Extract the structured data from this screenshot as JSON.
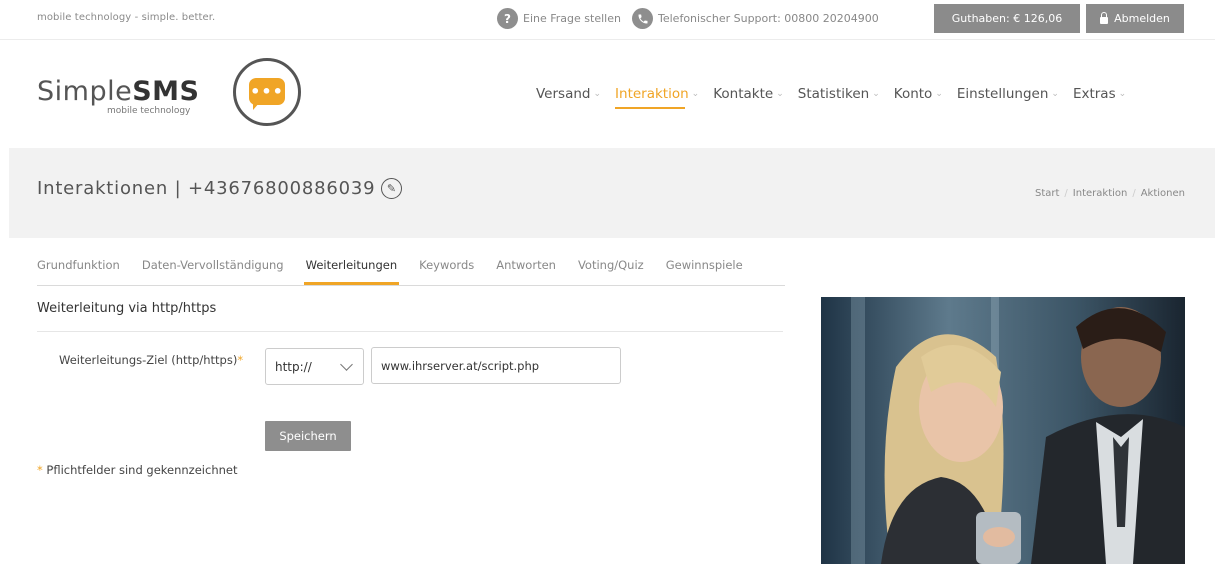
{
  "topbar": {
    "tagline": "mobile technology - simple. better.",
    "help_label": "Eine Frage stellen",
    "help_icon": "question-icon",
    "support_label": "Telefonischer Support: 00800 20204900",
    "support_icon": "phone-icon",
    "balance_label": "Guthaben: € 126,06",
    "logout_label": "Abmelden",
    "logout_icon": "lock-icon"
  },
  "logo": {
    "word_light": "Simple",
    "word_bold": "SMS",
    "subtitle": "mobile technology",
    "bubble_text": "•••"
  },
  "nav": {
    "items": [
      {
        "label": "Versand"
      },
      {
        "label": "Interaktion"
      },
      {
        "label": "Kontakte"
      },
      {
        "label": "Statistiken"
      },
      {
        "label": "Konto"
      },
      {
        "label": "Einstellungen"
      },
      {
        "label": "Extras"
      }
    ],
    "chevron": "⌄"
  },
  "page": {
    "title": "Interaktionen | +43676800886039",
    "edit_glyph": "✎",
    "breadcrumb": [
      "Start",
      "Interaktion",
      "Aktionen"
    ],
    "breadcrumb_sep": "/"
  },
  "tabs": [
    {
      "label": "Grundfunktion"
    },
    {
      "label": "Daten-Vervollständigung"
    },
    {
      "label": "Weiterleitungen"
    },
    {
      "label": "Keywords"
    },
    {
      "label": "Antworten"
    },
    {
      "label": "Voting/Quiz"
    },
    {
      "label": "Gewinnspiele"
    }
  ],
  "form": {
    "section_title": "Weiterleitung via http/https",
    "field_label": "Weiterleitungs-Ziel (http/https)",
    "required_mark": "*",
    "protocol_value": "http://",
    "url_value": "www.ihrserver.at/script.php",
    "save_label": "Speichern",
    "required_note": "Pflichtfelder sind gekennzeichnet"
  },
  "colors": {
    "accent": "#f0a526",
    "button_gray": "#8b8b8b",
    "band_gray": "#f2f2f2"
  }
}
